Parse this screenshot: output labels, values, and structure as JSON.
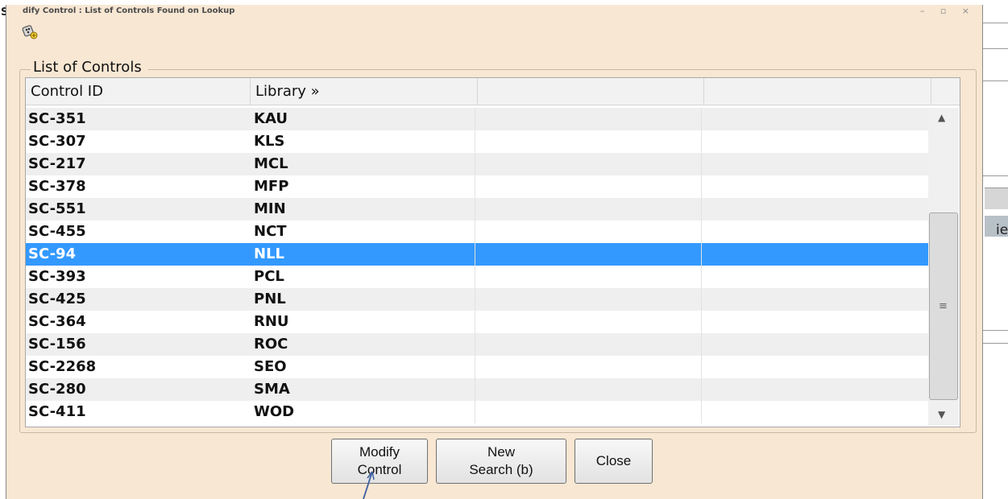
{
  "window": {
    "title": "dify Control : List of Controls Found on Lookup",
    "controls": "–  ▫  ×"
  },
  "background": {
    "left_letter": "S",
    "right_text": "ie"
  },
  "group": {
    "label": "List of Controls"
  },
  "table": {
    "headers": [
      "Control ID",
      "Library »",
      "",
      ""
    ],
    "rows": [
      {
        "id": "SC-351",
        "library": "KAU"
      },
      {
        "id": "SC-307",
        "library": "KLS"
      },
      {
        "id": "SC-217",
        "library": "MCL"
      },
      {
        "id": "SC-378",
        "library": "MFP"
      },
      {
        "id": "SC-551",
        "library": "MIN"
      },
      {
        "id": "SC-455",
        "library": "NCT"
      },
      {
        "id": "SC-94",
        "library": "NLL",
        "selected": true
      },
      {
        "id": "SC-393",
        "library": "PCL"
      },
      {
        "id": "SC-425",
        "library": "PNL"
      },
      {
        "id": "SC-364",
        "library": "RNU"
      },
      {
        "id": "SC-156",
        "library": "ROC"
      },
      {
        "id": "SC-2268",
        "library": "SEO"
      },
      {
        "id": "SC-280",
        "library": "SMA"
      },
      {
        "id": "SC-411",
        "library": "WOD"
      }
    ]
  },
  "buttons": {
    "modify": "Modify\nControl",
    "new_search": "New\nSearch (b)",
    "close": "Close"
  },
  "colors": {
    "dialog_bg": "#f7e7d3",
    "selection": "#3399ff",
    "alt_row": "#efefef"
  },
  "icons": {
    "app": "lookup-icon",
    "scroll_up": "scroll-up-arrow-icon",
    "scroll_down": "scroll-down-arrow-icon"
  }
}
